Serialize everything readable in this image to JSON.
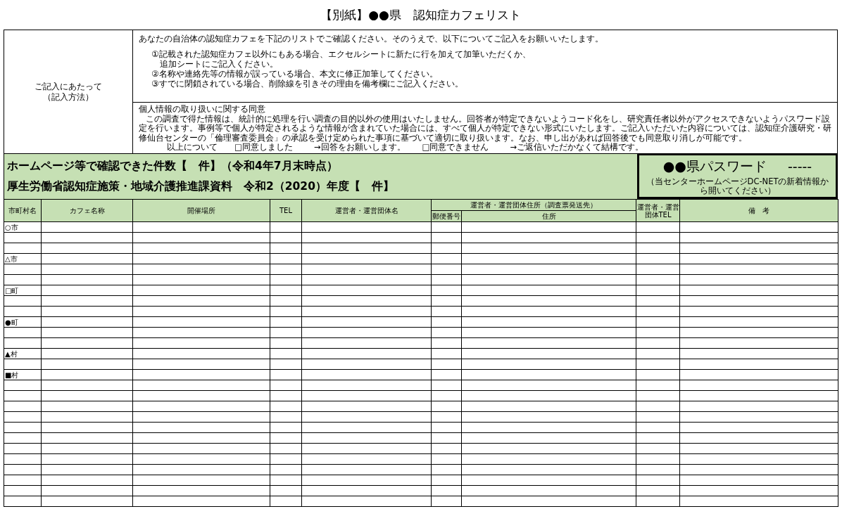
{
  "title": "【別紙】●●県　認知症カフェリスト",
  "guide": {
    "label": "ご記入にあたって",
    "sublabel": "（記入方法）",
    "intro": "あなたの自治体の認知症カフェを下記のリストでご確認ください。そのうえで、以下についてご記入をお願いいたします。",
    "lines": [
      {
        "kind": "item",
        "text": "①記載された認知症カフェ以外にもある場合、エクセルシートに新たに行を加えて加筆いただくか、"
      },
      {
        "kind": "continuation",
        "text": "追加シートにご記入ください。"
      },
      {
        "kind": "item",
        "text": "②名称や連絡先等の情報が誤っている場合、本文に修正加筆してください。"
      },
      {
        "kind": "item",
        "text": "③すでに閉鎖されている場合、削除線を引きその理由を備考欄にご記入ください。"
      }
    ]
  },
  "consent": {
    "heading": "個人情報の取り扱いに関する同意",
    "body": "この調査で得た情報は、統計的に処理を行い調査の目的以外の使用はいたしません。回答者が特定できないようコード化をし、研究責任者以外がアクセスできないようパスワード設定を行います。事例等で個人が特定されるような情報が含まれていた場合には、すべて個人が特定できない形式にいたします。ご記入いただいた内容については、認知症介護研究・研修仙台センターの「倫理審査委員会」の承認を受け定められた事項に基づいて適切に取り扱います。なお、申し出があれば回答後でも同意取り消しが可能です。",
    "options_label": "以上について",
    "options": [
      {
        "label": "□同意しました",
        "note": "→回答をお願いします。"
      },
      {
        "label": "□同意できません",
        "note": "→ご返信いただかなくて結構です。"
      }
    ]
  },
  "summary": {
    "lines": [
      "ホームページ等で確認できた件数【　件】（令和4年7月末時点）",
      "厚生労働省認知症施策・地域介護推進課資料　令和2（2020）年度【　件】"
    ],
    "password": {
      "label": "●●県パスワード",
      "value": "-----",
      "hint": "（当センターホームページDC-NETの新着情報から開いてください）"
    }
  },
  "table": {
    "columns": [
      {
        "label": "市町村名"
      },
      {
        "label": "カフェ名称"
      },
      {
        "label": "開催場所"
      },
      {
        "label": "TEL"
      },
      {
        "label": "運営者・運営団体名"
      },
      {
        "label": "運営者・運営団体住所（調査票発送先）",
        "children": [
          {
            "label": "郵便番号"
          },
          {
            "label": "住所"
          }
        ]
      },
      {
        "label": "運営者・運営団体TEL"
      },
      {
        "label": "備　考"
      }
    ],
    "rows": [
      {
        "municipality": "○市"
      },
      {},
      {},
      {
        "municipality": "△市"
      },
      {},
      {},
      {
        "municipality": "□町"
      },
      {},
      {},
      {
        "municipality": "●町"
      },
      {},
      {},
      {
        "municipality": "▲村"
      },
      {},
      {
        "municipality": "■村"
      },
      {},
      {},
      {},
      {},
      {},
      {},
      {},
      {},
      {},
      {},
      {},
      {}
    ]
  }
}
